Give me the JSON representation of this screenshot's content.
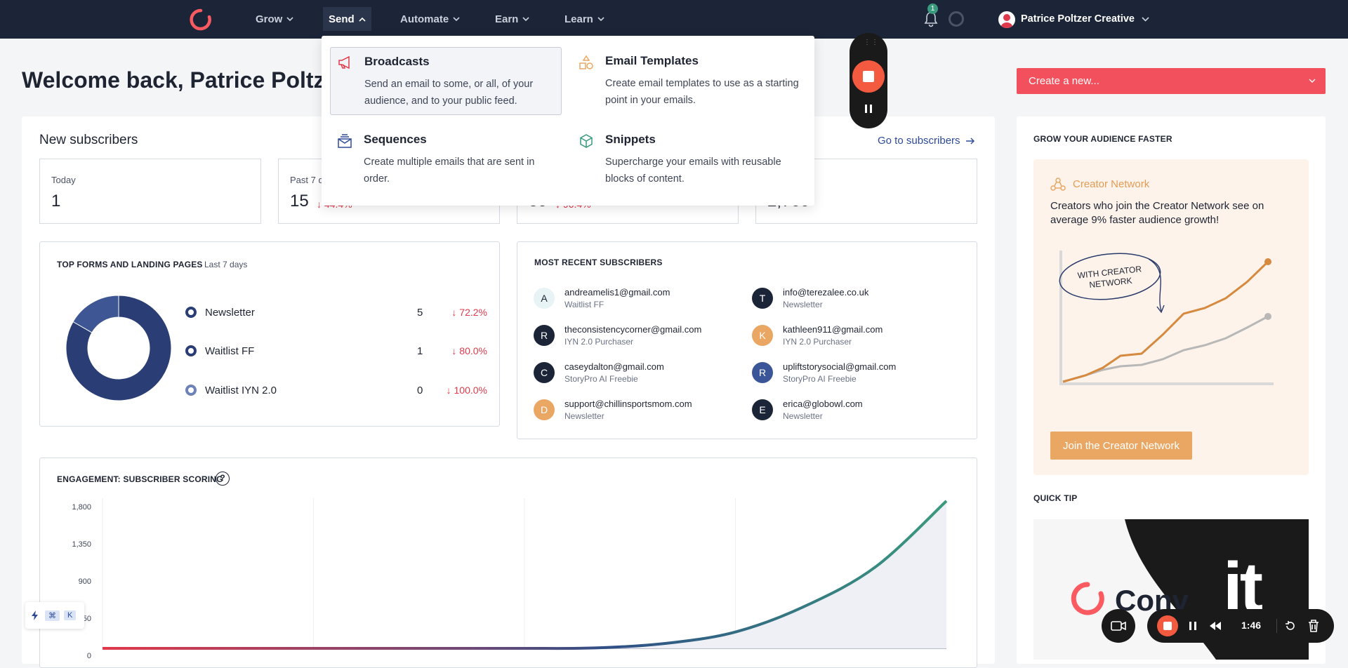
{
  "nav": {
    "items": [
      {
        "label": "Grow"
      },
      {
        "label": "Send"
      },
      {
        "label": "Automate"
      },
      {
        "label": "Earn"
      },
      {
        "label": "Learn"
      }
    ],
    "notification_count": "1",
    "user_name": "Patrice Poltzer Creative"
  },
  "send_menu": {
    "items": [
      {
        "title": "Broadcasts",
        "desc": "Send an email to some, or all, of your audience, and to your public feed.",
        "icon": "megaphone-icon"
      },
      {
        "title": "Email Templates",
        "desc": "Create email templates to use as a starting point in your emails.",
        "icon": "shapes-icon"
      },
      {
        "title": "Sequences",
        "desc": "Create multiple emails that are sent in order.",
        "icon": "stacked-mail-icon"
      },
      {
        "title": "Snippets",
        "desc": "Supercharge your emails with reusable blocks of content.",
        "icon": "cube-icon"
      }
    ]
  },
  "page": {
    "welcome": "Welcome back, Patrice Poltze",
    "create_new": "Create a new..."
  },
  "subscribers": {
    "title": "New subscribers",
    "goto": "Go to subscribers",
    "stats": [
      {
        "label": "Today",
        "value": "1",
        "change": ""
      },
      {
        "label": "Past 7 d",
        "value": "15",
        "change": "44.4%"
      },
      {
        "label": "",
        "value": "59",
        "change": "96.4%"
      },
      {
        "label": "",
        "value": "2,760",
        "change": ""
      }
    ]
  },
  "forms": {
    "title": "TOP FORMS AND LANDING PAGES",
    "period": "Last 7 days",
    "rows": [
      {
        "name": "Newsletter",
        "count": "5",
        "change": "72.2%"
      },
      {
        "name": "Waitlist FF",
        "count": "1",
        "change": "80.0%"
      },
      {
        "name": "Waitlist IYN 2.0",
        "count": "0",
        "change": "100.0%"
      }
    ],
    "chart_data": {
      "type": "pie",
      "categories": [
        "Newsletter",
        "Waitlist FF",
        "Waitlist IYN 2.0"
      ],
      "values": [
        5,
        1,
        0
      ]
    }
  },
  "recent": {
    "title": "MOST RECENT SUBSCRIBERS",
    "left": [
      {
        "initial": "A",
        "email": "andreamelis1@gmail.com",
        "source": "Waitlist FF",
        "color": "#e8f3f6",
        "text": "#1f2433"
      },
      {
        "initial": "R",
        "email": "theconsistencycorner@gmail.com",
        "source": "IYN 2.0 Purchaser",
        "color": "#1c2538",
        "text": "#ffffff"
      },
      {
        "initial": "C",
        "email": "caseydalton@gmail.com",
        "source": "StoryPro AI Freebie",
        "color": "#1c2538",
        "text": "#ffffff"
      },
      {
        "initial": "D",
        "email": "support@chillinsportsmom.com",
        "source": "Newsletter",
        "color": "#e9a763",
        "text": "#ffffff"
      }
    ],
    "right": [
      {
        "initial": "T",
        "email": "info@terezalee.co.uk",
        "source": "Newsletter",
        "color": "#1c2538",
        "text": "#ffffff"
      },
      {
        "initial": "K",
        "email": "kathleen911@gmail.com",
        "source": "IYN 2.0 Purchaser",
        "color": "#e9a763",
        "text": "#ffffff"
      },
      {
        "initial": "R",
        "email": "upliftstorysocial@gmail.com",
        "source": "StoryPro AI Freebie",
        "color": "#3a5598",
        "text": "#ffffff"
      },
      {
        "initial": "E",
        "email": "erica@globowl.com",
        "source": "Newsletter",
        "color": "#1c2538",
        "text": "#ffffff"
      }
    ]
  },
  "engagement": {
    "title": "ENGAGEMENT: SUBSCRIBER SCORING",
    "help": "?",
    "chart_data": {
      "type": "area",
      "yticks": [
        "1,800",
        "1,350",
        "900",
        "450",
        "0"
      ],
      "ylim": [
        0,
        1800
      ],
      "x": [
        0,
        1,
        2,
        3,
        4,
        5,
        6,
        7,
        8,
        9,
        10,
        11,
        12
      ],
      "y": [
        0,
        0,
        0,
        0,
        0,
        0,
        0,
        5,
        60,
        200,
        520,
        1000,
        1800
      ]
    }
  },
  "sidebar": {
    "grow_title": "GROW YOUR AUDIENCE FASTER",
    "network_title": "Creator Network",
    "network_desc": "Creators who join the Creator Network see on average 9% faster audience growth!",
    "bubble": "WITH CREATOR NETWORK",
    "join_button": "Join the Creator Network",
    "tip_title": "QUICK TIP",
    "tip_brand": "Conv",
    "tip_text": "it"
  },
  "recorder": {
    "time": "1:46"
  },
  "shortcut": {
    "keys": [
      "⌘",
      "K"
    ]
  },
  "colors": {
    "brand": "#fb6970",
    "accent_teal": "#3a9a7e",
    "navy": "#1c2538",
    "orange": "#e9a763"
  }
}
